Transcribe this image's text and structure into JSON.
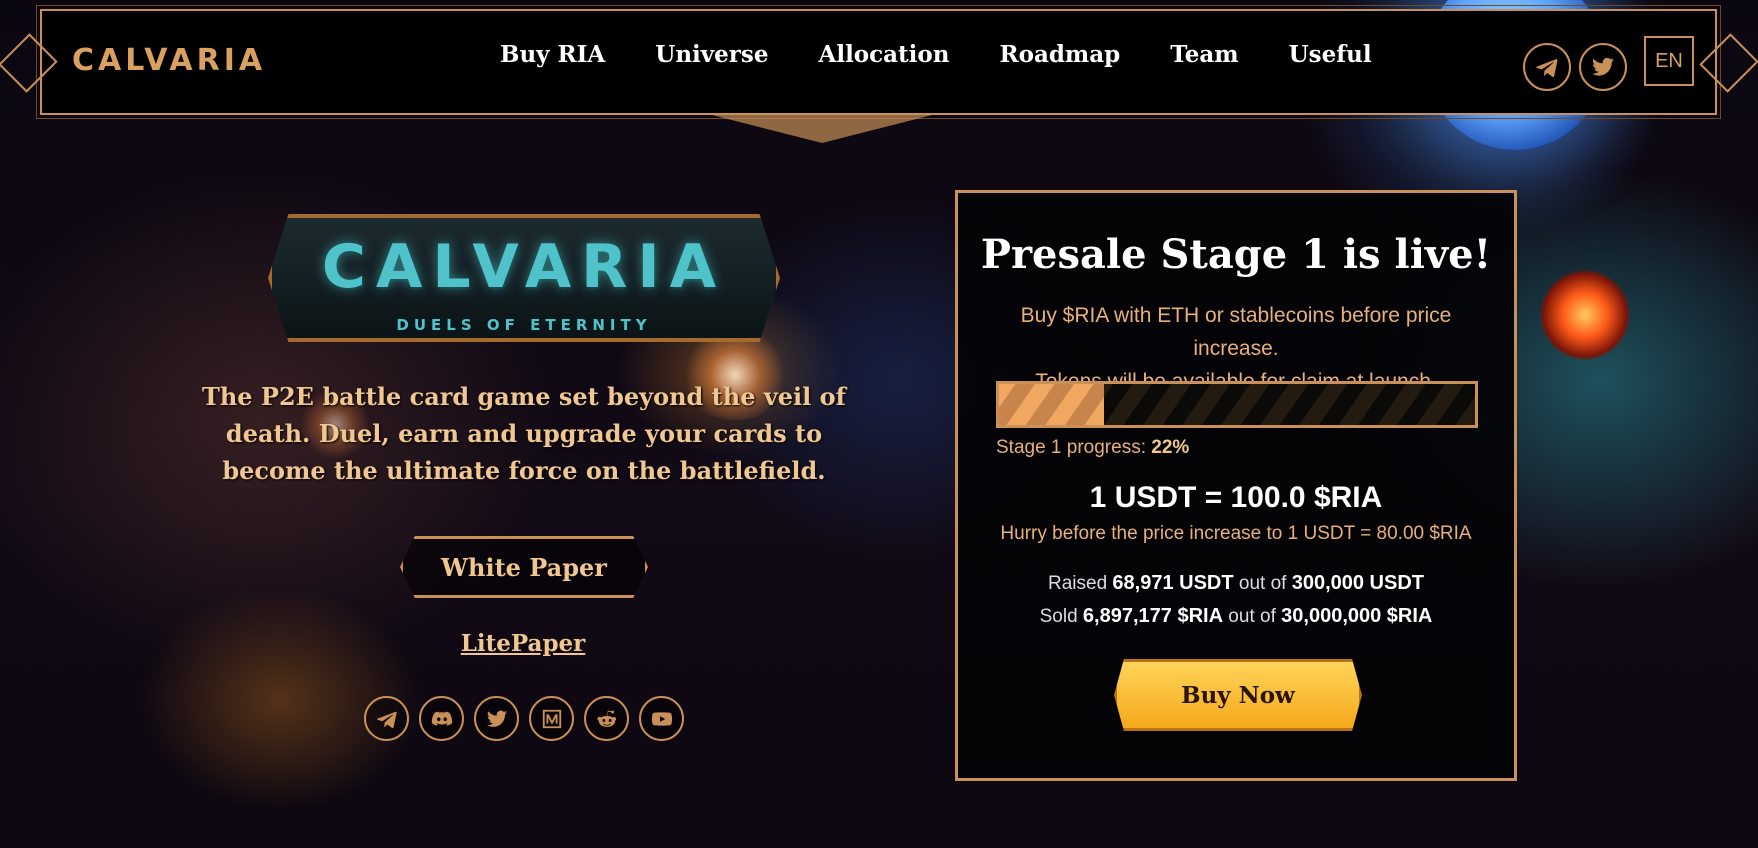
{
  "header": {
    "logo": "CALVARIA",
    "nav": [
      "Buy RIA",
      "Universe",
      "Allocation",
      "Roadmap",
      "Team",
      "Useful"
    ],
    "social_icons": [
      "telegram-icon",
      "twitter-icon"
    ],
    "language": "EN"
  },
  "hero": {
    "logo_title": "CALVARIA",
    "logo_subtitle": "DUELS OF ETERNITY",
    "tagline": "The P2E battle card game set beyond the veil of death. Duel, earn and upgrade your cards to become the ultimate force on the battlefield.",
    "white_paper_label": "White Paper",
    "lite_paper_label": "LitePaper",
    "social_icons": [
      "telegram-icon",
      "discord-icon",
      "twitter-icon",
      "medium-icon",
      "reddit-icon",
      "youtube-icon"
    ]
  },
  "presale": {
    "heading": "Presale Stage 1 is live!",
    "desc_line1": "Buy $RIA with ETH or stablecoins before price increase.",
    "desc_line2": "Tokens will be available for claim at launch.",
    "progress_percent": 22,
    "progress_label": "Stage 1 progress: ",
    "progress_value": "22%",
    "rate": "1 USDT = 100.0 $RIA",
    "hurry": "Hurry before the price increase to 1 USDT = 80.00 $RIA",
    "raised_prefix": "Raised ",
    "raised_value": "68,971 USDT",
    "raised_mid": " out of ",
    "raised_total": "300,000 USDT",
    "sold_prefix": "Sold ",
    "sold_value": "6,897,177 $RIA",
    "sold_mid": " out of ",
    "sold_total": "30,000,000 $RIA",
    "buy_label": "Buy Now"
  },
  "colors": {
    "accent": "#c99058",
    "gold_text": "#f0c790",
    "button": "#ffc93a"
  }
}
